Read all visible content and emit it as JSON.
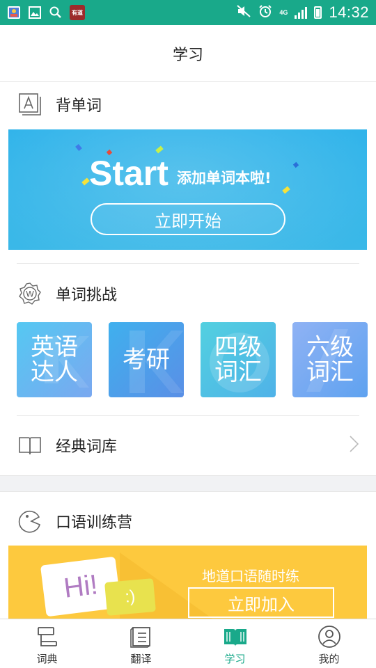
{
  "status_bar": {
    "time": "14:32",
    "network": "4G"
  },
  "header": {
    "title": "学习"
  },
  "sections": {
    "vocab": {
      "label": "背单词"
    },
    "challenge": {
      "label": "单词挑战"
    },
    "classic": {
      "label": "经典词库"
    },
    "oral": {
      "label": "口语训练营"
    }
  },
  "start_banner": {
    "title": "Start",
    "subtitle": "添加单词本啦!",
    "button_label": "立即开始"
  },
  "challenge_tiles": [
    {
      "line1": "英语",
      "line2": "达人"
    },
    {
      "line1": "考研",
      "line2": ""
    },
    {
      "line1": "四级",
      "line2": "词汇"
    },
    {
      "line1": "六级",
      "line2": "词汇"
    }
  ],
  "oral_banner": {
    "bubble_text": "Hi!",
    "smile_text": ":)",
    "subtitle": "地道口语随时练",
    "button_label": "立即加入"
  },
  "bottom_nav": [
    {
      "label": "词典",
      "icon": "dictionary-icon",
      "active": false
    },
    {
      "label": "翻译",
      "icon": "translate-icon",
      "active": false
    },
    {
      "label": "学习",
      "icon": "study-book-icon",
      "active": true
    },
    {
      "label": "我的",
      "icon": "profile-icon",
      "active": false
    }
  ],
  "colors": {
    "status_bar": "#19a98a",
    "accent": "#19a98a",
    "start_banner": "#2fb3ea",
    "oral_banner": "#fdc93e"
  }
}
